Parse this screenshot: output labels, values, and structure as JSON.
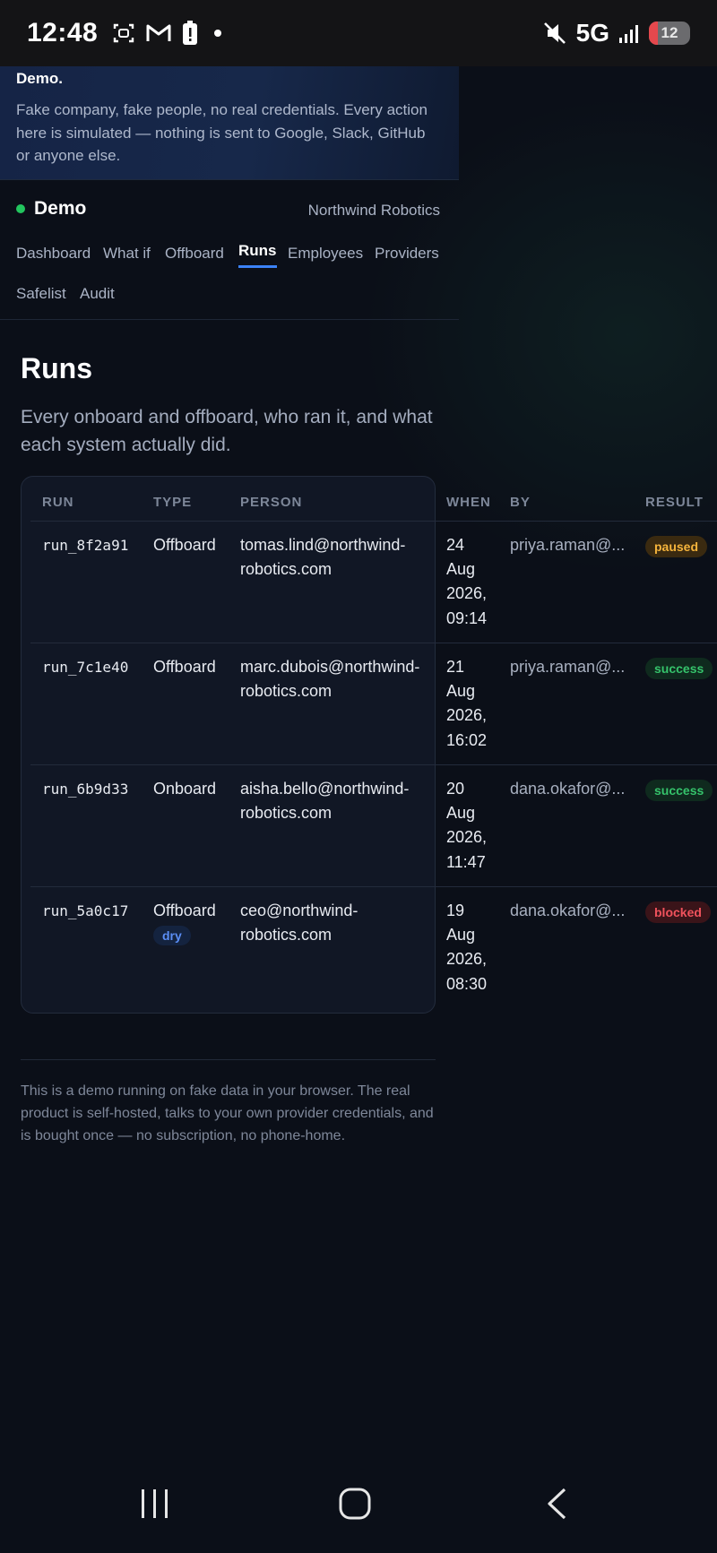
{
  "status_bar": {
    "time": "12:48",
    "network": "5G",
    "battery": "12",
    "icons": [
      "screenshot-icon",
      "gmail-icon",
      "battery-alert-icon",
      "mute-icon",
      "signal-icon"
    ]
  },
  "banner": {
    "title": "Demo.",
    "text": "Fake company, fake people, no real credentials. Every action here is simulated — nothing is sent to Google, Slack, GitHub or anyone else."
  },
  "app": {
    "brand": "Demo",
    "company": "Northwind Robotics",
    "nav": [
      {
        "label": "Dashboard"
      },
      {
        "label": "What if"
      },
      {
        "label": "Offboard"
      },
      {
        "label": "Runs",
        "active": true
      },
      {
        "label": "Employees"
      },
      {
        "label": "Providers"
      },
      {
        "label": "Safelist"
      },
      {
        "label": "Audit"
      }
    ]
  },
  "page": {
    "title": "Runs",
    "description": "Every onboard and offboard, who ran it, and what each system actually did."
  },
  "table": {
    "columns": [
      "RUN",
      "TYPE",
      "PERSON",
      "WHEN",
      "BY",
      "RESULT"
    ],
    "rows": [
      {
        "run": "run_8f2a91",
        "type": "Offboard",
        "person_1": "tomas.lind@northwind-",
        "person_2": "robotics.com",
        "when": [
          "24",
          "Aug",
          "2026,",
          "09:14"
        ],
        "by": "priya.raman@...",
        "result": "paused"
      },
      {
        "run": "run_7c1e40",
        "type": "Offboard",
        "person_1": "marc.dubois@northwind-",
        "person_2": "robotics.com",
        "when": [
          "21",
          "Aug",
          "2026,",
          "16:02"
        ],
        "by": "priya.raman@...",
        "result": "success"
      },
      {
        "run": "run_6b9d33",
        "type": "Onboard",
        "person_1": "aisha.bello@northwind-",
        "person_2": "robotics.com",
        "when": [
          "20",
          "Aug",
          "2026,",
          "11:47"
        ],
        "by": "dana.okafor@...",
        "result": "success"
      },
      {
        "run": "run_5a0c17",
        "type": "Offboard",
        "tag": "dry",
        "person_1": "ceo@northwind-",
        "person_2": "robotics.com",
        "when": [
          "19",
          "Aug",
          "2026,",
          "08:30"
        ],
        "by": "dana.okafor@...",
        "result": "blocked"
      }
    ]
  },
  "footer": "This is a demo running on fake data in your browser. The real product is self-hosted, talks to your own provider credentials, and is bought once — no subscription, no phone-home.",
  "colors": {
    "accent": "#3b82f6",
    "paused": "#f5b43c",
    "success": "#35c36b",
    "blocked": "#f0525c",
    "online": "#22c55e"
  }
}
